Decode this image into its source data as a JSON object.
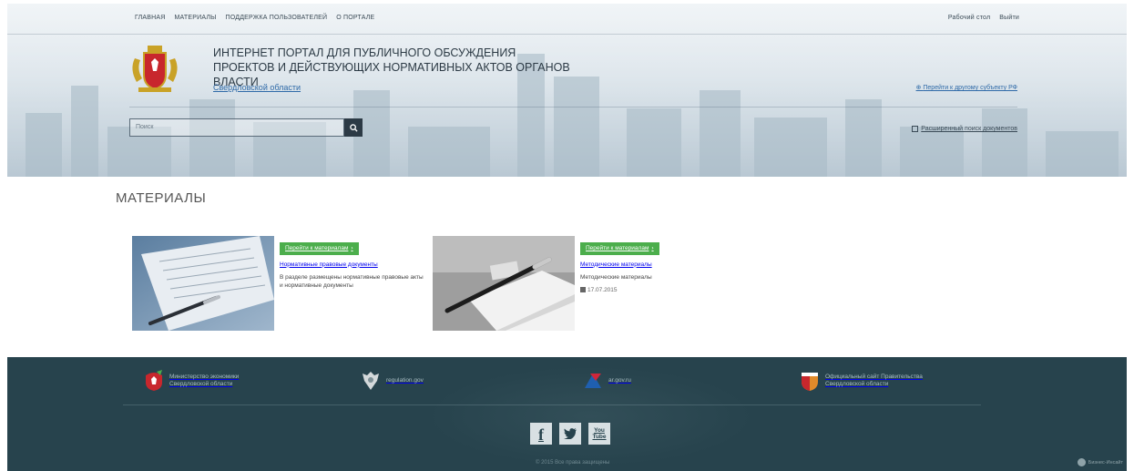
{
  "topnav": {
    "links": [
      "ГЛАВНАЯ",
      "МАТЕРИАЛЫ",
      "ПОДДЕРЖКА ПОЛЬЗОВАТЕЛЕЙ",
      "О ПОРТАЛЕ"
    ],
    "right": [
      "Рабочий стол",
      "Выйти"
    ]
  },
  "header": {
    "title": "ИНТЕРНЕТ ПОРТАЛ ДЛЯ ПУБЛИЧНОГО ОБСУЖДЕНИЯ ПРОЕКТОВ И ДЕЙСТВУЮЩИХ НОРМАТИВНЫХ АКТОВ ОРГАНОВ ВЛАСТИ",
    "region": "Свердловской области",
    "other_subject_link": "Перейти к другому субъекту РФ",
    "emblem_icon": "coat-of-arms-icon"
  },
  "search": {
    "placeholder": "Поиск",
    "advanced_link": "Расширенный поиск документов"
  },
  "main": {
    "title": "МАТЕРИАЛЫ",
    "cards": [
      {
        "button": "Перейти к материалам",
        "category": "Нормативные правовые документы",
        "description": "В разделе размещены нормативные правовые акты и нормативные документы",
        "date": ""
      },
      {
        "button": "Перейти к материалам",
        "category": "Методические материалы",
        "description": "Методические материалы",
        "date": "17.07.2015"
      }
    ]
  },
  "footer": {
    "links": [
      {
        "label": "Министерство экономики Свердловской области",
        "icon": "ministry-emblem-icon"
      },
      {
        "label": "regulation.gov",
        "icon": "russia-eagle-icon"
      },
      {
        "label": "ar.gov.ru",
        "icon": "ar-logo-icon"
      },
      {
        "label": "Официальный сайт Правительства Свердловской области",
        "icon": "government-shield-icon"
      }
    ],
    "socials": [
      "facebook-icon",
      "twitter-icon",
      "youtube-icon"
    ],
    "copyright": "© 2015 Все права защищены",
    "counter": "Бизнес-Инсайт"
  },
  "colors": {
    "accent_green": "#4cae4c",
    "link_blue": "#2f6aa8",
    "footer_bg": "#27434d"
  }
}
